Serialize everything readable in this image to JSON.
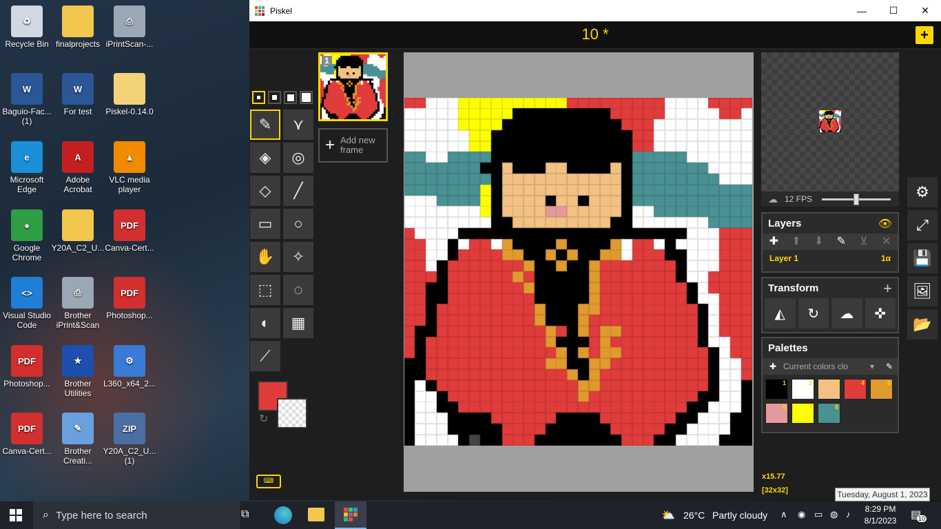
{
  "desktop": {
    "icons": [
      {
        "label": "Recycle Bin",
        "kind": "recycle-bin-icon",
        "glyph": "♻",
        "color": "#cfd8e3"
      },
      {
        "label": "finalprojects",
        "kind": "folder-icon",
        "glyph": "",
        "color": "#f3c64e"
      },
      {
        "label": "iPrintScan-...",
        "kind": "printer-icon",
        "glyph": "⎙",
        "color": "#9aa7b5"
      },
      {
        "label": "Baguio-Fac... (1)",
        "kind": "word-doc-icon",
        "glyph": "W",
        "color": "#2b5797"
      },
      {
        "label": "For test",
        "kind": "word-doc-icon",
        "glyph": "W",
        "color": "#2b5797"
      },
      {
        "label": "Piskel-0.14.0",
        "kind": "zip-folder-icon",
        "glyph": "",
        "color": "#f3d27a"
      },
      {
        "label": "Microsoft Edge",
        "kind": "edge-icon",
        "glyph": "e",
        "color": "#1b8fd8"
      },
      {
        "label": "Adobe Acrobat",
        "kind": "acrobat-icon",
        "glyph": "A",
        "color": "#c41f1f"
      },
      {
        "label": "VLC media player",
        "kind": "vlc-icon",
        "glyph": "▲",
        "color": "#f08a00"
      },
      {
        "label": "Google Chrome",
        "kind": "chrome-icon",
        "glyph": "●",
        "color": "#2f9e44"
      },
      {
        "label": "Y20A_C2_U...",
        "kind": "folder-icon",
        "glyph": "",
        "color": "#f3c64e"
      },
      {
        "label": "Canva-Cert...",
        "kind": "pdf-icon",
        "glyph": "PDF",
        "color": "#d32f2f"
      },
      {
        "label": "Visual Studio Code",
        "kind": "vscode-icon",
        "glyph": "<>",
        "color": "#1f7ed6"
      },
      {
        "label": "Brother iPrint&Scan",
        "kind": "printer-icon",
        "glyph": "⎙",
        "color": "#9aa7b5"
      },
      {
        "label": "Photoshop...",
        "kind": "pdf-icon",
        "glyph": "PDF",
        "color": "#d32f2f"
      },
      {
        "label": "Photoshop...",
        "kind": "pdf-icon",
        "glyph": "PDF",
        "color": "#d32f2f"
      },
      {
        "label": "Brother Utilities",
        "kind": "brother-utilities-icon",
        "glyph": "★",
        "color": "#1c4fae"
      },
      {
        "label": "L360_x64_2...",
        "kind": "installer-icon",
        "glyph": "⚙",
        "color": "#3a7bd5"
      },
      {
        "label": "Canva-Cert...",
        "kind": "pdf-icon",
        "glyph": "PDF",
        "color": "#d32f2f"
      },
      {
        "label": "Brother Creati...",
        "kind": "brother-creative-icon",
        "glyph": "✎",
        "color": "#6aa0e0"
      },
      {
        "label": "Y20A_C2_U... (1)",
        "kind": "zip-icon",
        "glyph": "ZIP",
        "color": "#4a6fa5"
      }
    ]
  },
  "window": {
    "app_title": "Piskel",
    "minimize": "—",
    "maximize": "☐",
    "close": "✕"
  },
  "piskel": {
    "doc_title": "10 *",
    "new_button": "+",
    "frame_number": "1",
    "add_frame_label": "Add new frame",
    "add_frame_plus": "+",
    "fps_label": "12 FPS",
    "fps_value": 12,
    "layers": {
      "title": "Layers",
      "layer_name": "Layer 1",
      "layer_opacity": "1α"
    },
    "transform": {
      "title": "Transform"
    },
    "palettes": {
      "title": "Palettes",
      "current": "Current colors clo",
      "swatches": [
        {
          "n": "1",
          "color": "#000000"
        },
        {
          "n": "2",
          "color": "#ffffff"
        },
        {
          "n": "3",
          "color": "#f3c283"
        },
        {
          "n": "4",
          "color": "#e03c3c"
        },
        {
          "n": "5",
          "color": "#e09a2e"
        },
        {
          "n": "6",
          "color": "#e49a9a"
        },
        {
          "n": "7",
          "color": "#ffff00"
        },
        {
          "n": "8",
          "color": "#4a9193"
        }
      ]
    },
    "primary_color": "#e03c3c",
    "zoom_label": "x15.77",
    "size_label": "[32x32]"
  },
  "taskbar": {
    "search_placeholder": "Type here to search",
    "weather_temp": "26°C",
    "weather_text": "Partly cloudy",
    "time": "8:29 PM",
    "date": "8/1/2023",
    "tooltip": "Tuesday, August 1, 2023",
    "notification_count": "10"
  },
  "pixel_art": [
    "RRWWWYYYYYYYYYYRRRRRRRRRWWWWRRRR",
    "WWWWWYYYYYKKKKKKKKKRRRRRWWWWWRRW",
    "WWWWWYYYYKKKKKKKKKKKRRRWWWWWWWWW",
    "WWWWWWYYKKKKKKKKKKKKKRRWWWWWWWWW",
    "WWWWWWYYKKKKKKKKKKKKKRRWWWWWWWWW",
    "TTWWTTTTKKKKKKKKKKKKKTTTTTWWWWWW",
    "TTTTTTTKKSKKKSSKKKKSKTTTTTTTWWWW",
    "TTTTTTTTKSSSSSSSSSSSKTTTTTTTTWWW",
    "TTTTTTTYKSSSSSSSSSSSKTTTTTTTTTTT",
    "WWWTTTTYKSSSSKSSKSSSKTTTTTTTTTTT",
    "WWWWWWWYKSSSSPPSSSSSKWWTTTTTTTTT",
    "WWWWWWWWKKSSSSSSSSSKKWWWWWWWTTTT",
    "RWWWWKKKKKKKKKKKKKKKKKKKKKWWWRRR",
    "RRWWKWRRWOKKKKOKKKKOWRRWKWWWWRRR",
    "RRWWKRRRROOKKOKOKKOOWRRRKKWWWRRR",
    "RRWKRRRRRRROKKOKKORRRRRRRKWWWRRR",
    "RRRKRRRRRRORKKKKKORRRRRRRKWWRRRR",
    "RRKKRRRRRRROKKKKKORRRRRRRRKWRRRR",
    "RRKKRRRRRRRRKKKKKORRRRRRRRKWWRRR",
    "RRKRRRRRRRRROKKKOORRRRRRRRRKWRRR",
    "RRKRRRRRRRRROKKKORRRRRRRRRRKWRRR",
    "RKKRRRRRRRRRRORKOROORRRRRRRKWRRR",
    "RKRRRRRRRRRRROKKKRORRRRRRRRKWWRR",
    "RKRRRRRRRRRRRROKOROORRRRRRRRKWRR",
    "KKRRRRRRRRRRROOKKOORRRRRRRRRKWWR",
    "KKRRRRRRRRRRRRROKORRRRRRRRRRKWWR",
    "KWKRRRRRRRRRRRRROORRRRRRRRRRKWWK",
    "KWWKRRRRRRRRRRRRORRRRRRRRRRKKWWK",
    "KWWKKRRRRRRRRRRRRRRRRRRRRRKKWWWK",
    "KWWWKKKKRRRRRRKKKKRRRRRRRKKWWWKK",
    "KWWWKKKKKRRRRKKKKKKRRRRRKKWWWWKK",
    "KWWWWKGKKRRRKKKKKKKKRRRKKWWWWKKK"
  ]
}
